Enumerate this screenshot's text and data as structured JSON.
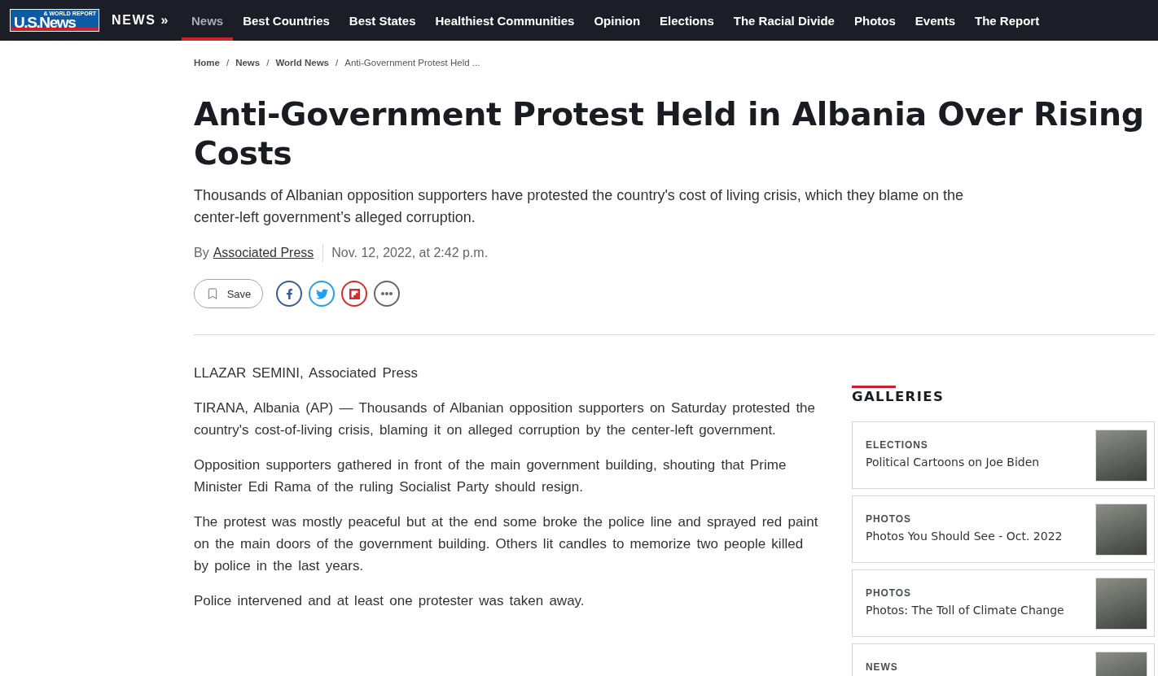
{
  "nav": {
    "logo": {
      "wordmark": "U.S.News",
      "tagline": "& WORLD REPORT"
    },
    "section": "NEWS »",
    "items": [
      {
        "label": "News",
        "selected": true
      },
      {
        "label": "Best Countries",
        "selected": false
      },
      {
        "label": "Best States",
        "selected": false
      },
      {
        "label": "Healthiest Communities",
        "selected": false
      },
      {
        "label": "Opinion",
        "selected": false
      },
      {
        "label": "Elections",
        "selected": false
      },
      {
        "label": "The Racial Divide",
        "selected": false
      },
      {
        "label": "Photos",
        "selected": false
      },
      {
        "label": "Events",
        "selected": false
      },
      {
        "label": "The Report",
        "selected": false
      }
    ]
  },
  "breadcrumb": [
    {
      "kind": "link",
      "label": "Home"
    },
    {
      "kind": "separator",
      "label": "/"
    },
    {
      "kind": "link",
      "label": "News"
    },
    {
      "kind": "separator",
      "label": "/"
    },
    {
      "kind": "link",
      "label": "World News"
    },
    {
      "kind": "separator",
      "label": "/"
    },
    {
      "kind": "current",
      "label": "Anti-Government Protest Held ..."
    }
  ],
  "article": {
    "title": "Anti-Government Protest Held in Albania Over Rising Costs",
    "dek": "Thousands of Albanian opposition supporters have protested the country's cost of living crisis, which they blame on the center-left government’s alleged corruption.",
    "byline": {
      "prefix": "By",
      "author": "Associated Press",
      "date": "Nov. 12, 2022, at 2:42 p.m."
    },
    "save": {
      "label": "Save"
    },
    "share": [
      {
        "kind": "facebook"
      },
      {
        "kind": "twitter"
      },
      {
        "kind": "flipboard"
      },
      {
        "kind": "more"
      }
    ],
    "credit": "LLAZAR SEMINI, Associated Press",
    "paragraphs": [
      "TIRANA, Albania (AP) — Thousands of Albanian opposition supporters on Saturday protested the country's cost-of-living crisis, blaming it on alleged corruption by the center-left government.",
      "Opposition supporters gathered in front of the main government building, shouting that Prime Minister Edi Rama of the ruling Socialist Party should resign.",
      "The protest was mostly peaceful but at the end some broke the police line and sprayed red paint on the main doors of the government building. Others lit candles to memorize two people killed by police in the last years.",
      "Police intervened and at least one protester was taken away."
    ]
  },
  "sidebar": {
    "heading": "GALLERIES",
    "cards": [
      {
        "category": "ELECTIONS",
        "title": "Political Cartoons on Joe Biden"
      },
      {
        "category": "PHOTOS",
        "title": "Photos You Should See - Oct. 2022"
      },
      {
        "category": "PHOTOS",
        "title": "Photos: The Toll of Climate Change"
      },
      {
        "category": "NEWS"
      }
    ]
  }
}
